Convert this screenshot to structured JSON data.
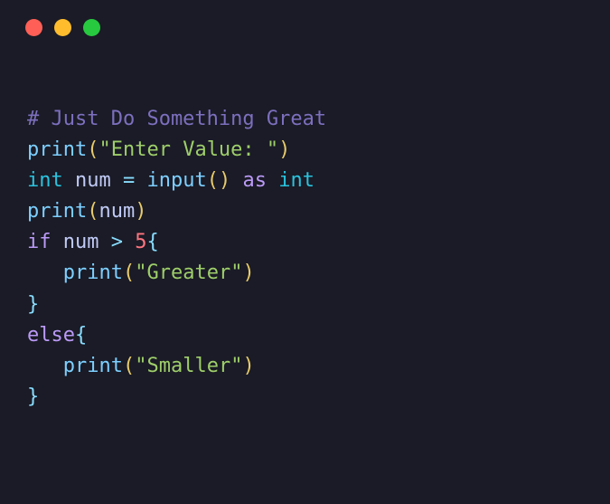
{
  "code": {
    "comment": "# Just Do Something Great",
    "print1_fn": "print",
    "print1_lp": "(",
    "print1_str": "\"Enter Value: \"",
    "print1_rp": ")",
    "int_kw": "int",
    "num_var": "num",
    "eq_op": "=",
    "input_fn": "input",
    "input_lp": "(",
    "input_rp": ")",
    "as_kw": "as",
    "int_type": "int",
    "print2_fn": "print",
    "print2_lp": "(",
    "print2_arg": "num",
    "print2_rp": ")",
    "if_kw": "if",
    "cond_var": "num",
    "gt_op": ">",
    "cond_num": "5",
    "lbrace1": "{",
    "print3_fn": "print",
    "print3_lp": "(",
    "print3_str": "\"Greater\"",
    "print3_rp": ")",
    "rbrace1": "}",
    "else_kw": "else",
    "lbrace2": "{",
    "print4_fn": "print",
    "print4_lp": "(",
    "print4_str": "\"Smaller\"",
    "print4_rp": ")",
    "rbrace2": "}"
  }
}
